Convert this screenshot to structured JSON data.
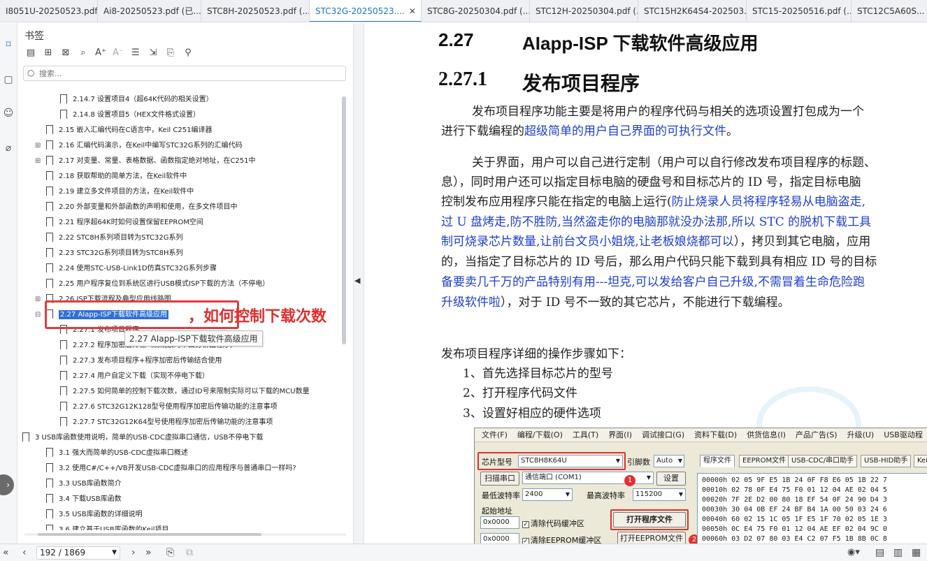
{
  "tabs": [
    {
      "label": "I8051U-20250523.pdf ..."
    },
    {
      "label": "Ai8-20250523.pdf (已..."
    },
    {
      "label": "STC8H-20250523.pdf (..."
    },
    {
      "label": "STC32G-20250523....",
      "active": true
    },
    {
      "label": "STC8G-20250304.pdf (..."
    },
    {
      "label": "STC12H-20250304.pdf (..."
    },
    {
      "label": "STC15H2K64S4-202503..."
    },
    {
      "label": "STC15-20250516.pdf (..."
    },
    {
      "label": "STC12C5A60S..."
    }
  ],
  "tab_close": "✕",
  "panel": {
    "title": "书签",
    "search_placeholder": "搜索..."
  },
  "bookmarks": [
    {
      "label": "2.14.7  设置项目4（超64K代码的相关设置）",
      "level": 2
    },
    {
      "label": "2.14.8  设置项目5（HEX文件格式设置）",
      "level": 2
    },
    {
      "label": "2.15  嵌入汇编代码在C语言中，Keil C251编译器",
      "level": 1
    },
    {
      "label": "2.16  汇编代码演示，在Keil中编写STC32G系列的汇编代码",
      "level": 1,
      "expander": "+"
    },
    {
      "label": "2.17  对变量、常量、表格数据、函数指定绝对地址，在C251中",
      "level": 1,
      "expander": "+"
    },
    {
      "label": "2.18  获取帮助的简单方法，在Keil软件中",
      "level": 1
    },
    {
      "label": "2.19  建立多文件项目的方法，在Keil软件中",
      "level": 1
    },
    {
      "label": "2.20  外部变量和外部函数的声明和使用，在多文件项目中",
      "level": 1
    },
    {
      "label": "2.21  程序超64K时如何设置保留EEPROM空间",
      "level": 1
    },
    {
      "label": "2.22  STC8H系列项目转为STC32G系列",
      "level": 1
    },
    {
      "label": "2.23  STC32G系列项目转为STC8H系列",
      "level": 1
    },
    {
      "label": "2.24  使用STC-USB-Link1D仿真STC32G系列步骤",
      "level": 1
    },
    {
      "label": "2.25  用户程序复位到系统区进行USB模式ISP下载的方法（不停电）",
      "level": 1
    },
    {
      "label": "2.26  ISP下载流程及典型应用线路图",
      "level": 1,
      "expander": "+"
    },
    {
      "label": "2.27  AIapp-ISP下载软件高级应用",
      "level": 1,
      "expander": "−",
      "selected": true
    },
    {
      "label": "2.27.1  发布项目程序",
      "level": 2
    },
    {
      "label": "2.27.2  程序加密后传输（防烧录时串口分析出程序）",
      "level": 2
    },
    {
      "label": "2.27.3  发布项目程序+程序加密后传输结合使用",
      "level": 2
    },
    {
      "label": "2.27.4  用户自定义下载（实现不停电下载）",
      "level": 2
    },
    {
      "label": "2.27.5  如何简单的控制下载次数，通过ID号来限制实际可以下载的MCU数量",
      "level": 2
    },
    {
      "label": "2.27.6  STC32G12K128型号使用程序加密后传输功能的注意事项",
      "level": 2
    },
    {
      "label": "2.27.7  STC32G12K64型号使用程序加密后传输功能的注意事项",
      "level": 2
    },
    {
      "label": "3  USB库函数使用说明，简单的USB-CDC虚拟串口通信，USB不停电下载",
      "level": 0,
      "expander": "−"
    },
    {
      "label": "3.1  强大而简单的USB-CDC虚拟串口概述",
      "level": 1
    },
    {
      "label": "3.2  使用C#/C++/VB开发USB-CDC虚拟串口的应用程序与普通串口一样吗?",
      "level": 1
    },
    {
      "label": "3.3  USB库函数简介",
      "level": 1
    },
    {
      "label": "3.4  下载USB库函数",
      "level": 1
    },
    {
      "label": "3.5  USB库函数的详细说明",
      "level": 1
    },
    {
      "label": "3.6  建立基于USB库函数的Keil项目",
      "level": 1
    }
  ],
  "annotation": "，如何控制下载次数",
  "tooltip": "2.27  AIapp-ISP下载软件高级应用",
  "doc": {
    "h1_num": "2.27",
    "h1_title": "AIapp-ISP 下载软件高级应用",
    "h2_num": "2.27.1",
    "h2_title": "发布项目程序",
    "p1a": "发布项目程序功能主要是将用户的程序代码与相关的选项设置打包成为一个",
    "p1b_plain": "进行下载编程的",
    "p1b_blue": "超级简单的用户自己界面的可执行文件",
    "p1b_end": "。",
    "p2a": "关于界面，用户可以自己进行定制（用户可以自行修改发布项目程序的标题、",
    "p2b": "息），同时用户还可以指定目标电脑的硬盘号和目标芯片的  ID  号，指定目标电脑",
    "p2c_plain": "控制发布应用程序只能在指定的电脑上运行(",
    "p2c_blue": "防止烧录人员将程序轻易从电脑盗走,",
    "p2d_blue": "过  U  盘烤走,防不胜防,当然盗走你的电脑那就没办法那,所以  STC  的脱机下载工具",
    "p2e_blue": "制可烧录芯片数量,让前台文员小姐烧,让老板娘烧都可以",
    "p2e_plain": "），拷贝到其它电脑，应用",
    "p2f": "的，当指定了目标芯片的 ID 号后，那么用户代码只能下载到具有相应 ID 号的目标",
    "p2g_blue": "备要卖几千万的产品特别有用---坦克,可以发给客户自己升级,不需冒着生命危险跑",
    "p2h_blue": "升级软件啦",
    "p2h_plain": "），对于 ID 号不一致的其它芯片，不能进行下载编程。",
    "steps_intro": "发布项目程序详细的操作步骤如下：",
    "step1": "1、首先选择目标芯片的型号",
    "step2": "2、打开程序代码文件",
    "step3": "3、设置好相应的硬件选项"
  },
  "figure": {
    "menu": [
      "文件(F)",
      "编程/下载(O)",
      "工具(T)",
      "界面(I)",
      "调试接口(G)",
      "资料下载(D)",
      "供货信息(I)",
      "产品广告(S)",
      "升级(U)",
      "USB驱动程"
    ],
    "chip_label": "芯片型号",
    "chip_value": "STC8H8K64U",
    "pin_label": "引脚数",
    "pin_value": "Auto",
    "scan_button": "扫描串口",
    "port_value": "通信端口 (COM1)",
    "settings_button": "设置",
    "min_baud_label": "最低波特率",
    "min_baud_value": "2400",
    "max_baud_label": "最高波特率",
    "max_baud_value": "115200",
    "start_addr_label": "起始地址",
    "addr1": "0x0000",
    "addr2": "0x0000",
    "clear_code": "清除代码缓冲区",
    "clear_eeprom": "清除EEPROM缓冲区",
    "open_program": "打开程序文件",
    "open_eeprom": "打开EEPROM文件",
    "badge1": "1",
    "badge2": "2",
    "ftabs": [
      "程序文件",
      "EEPROM文件",
      "USB-CDC/串口助手",
      "USB-HID助手",
      "Keil"
    ],
    "hex_rows": [
      "00000h  02 05 9F E5 1B 24 0F F8 E6 05 1B 22 7",
      "00010h  02 78 0F E4 75 F0 01 12 04 AE 02 04 5",
      "00020h  7F 2E D2 00 80 18 EF 54 0F 24 90 D4 3",
      "00030h  30 04 0B EF 24 BF B4 1A 00 50 03 24 6",
      "00040h  60 02 15 1C 05 1F E5 1F 70 02 05 1E 3",
      "00050h  0C E4 75 F0 01 12 04 AE EF 02 04 9C 0",
      "00060h  03 D2 07 80 03 E4 C2 07 F5 1B 8B 0C 8"
    ]
  },
  "status": {
    "page_value": "192 / 1869"
  }
}
